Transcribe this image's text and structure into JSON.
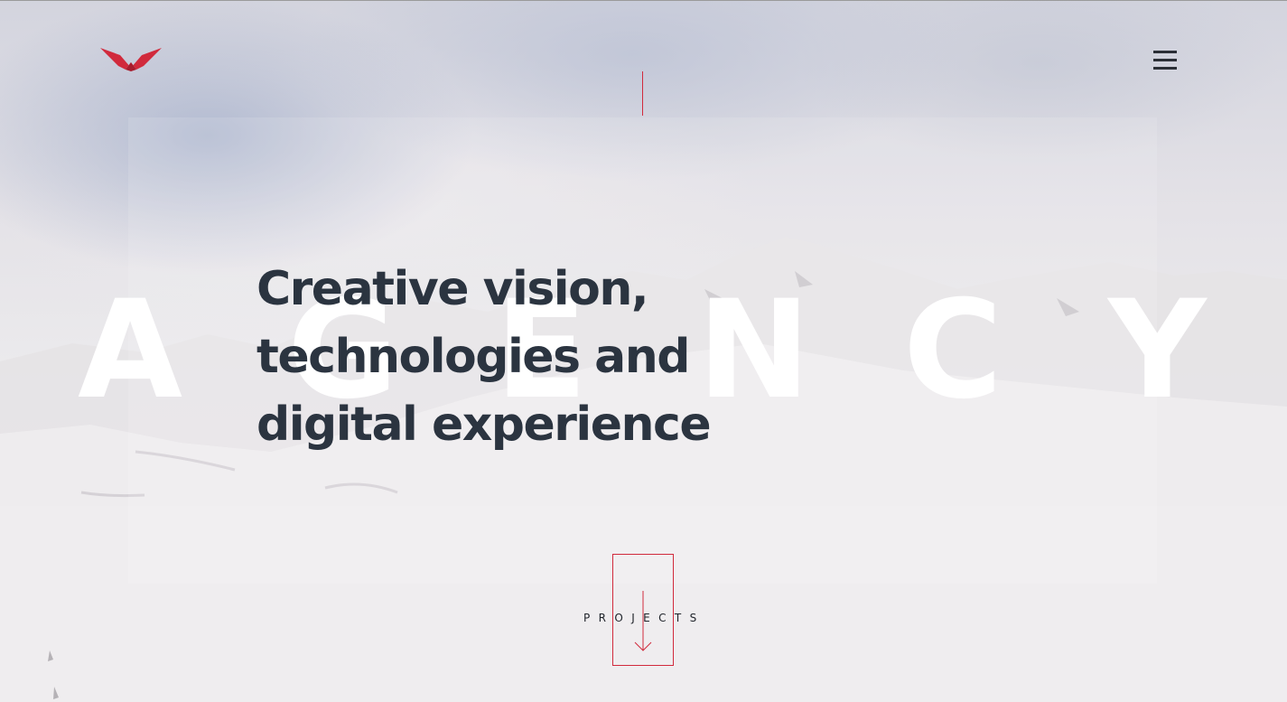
{
  "header": {
    "logo": "chevron-logo-icon",
    "menu_icon": "hamburger-menu-icon"
  },
  "hero": {
    "background_word": [
      "A",
      "G",
      "E",
      "N",
      "C",
      "Y"
    ],
    "headline_lines": [
      "Creative vision,",
      "technologies and",
      "digital experience"
    ]
  },
  "scroll_cta": {
    "label": "PROJECTS",
    "icon": "arrow-down-icon"
  },
  "colors": {
    "accent": "#d12a3c",
    "text": "#2b3440",
    "background": "#eceaeb"
  }
}
